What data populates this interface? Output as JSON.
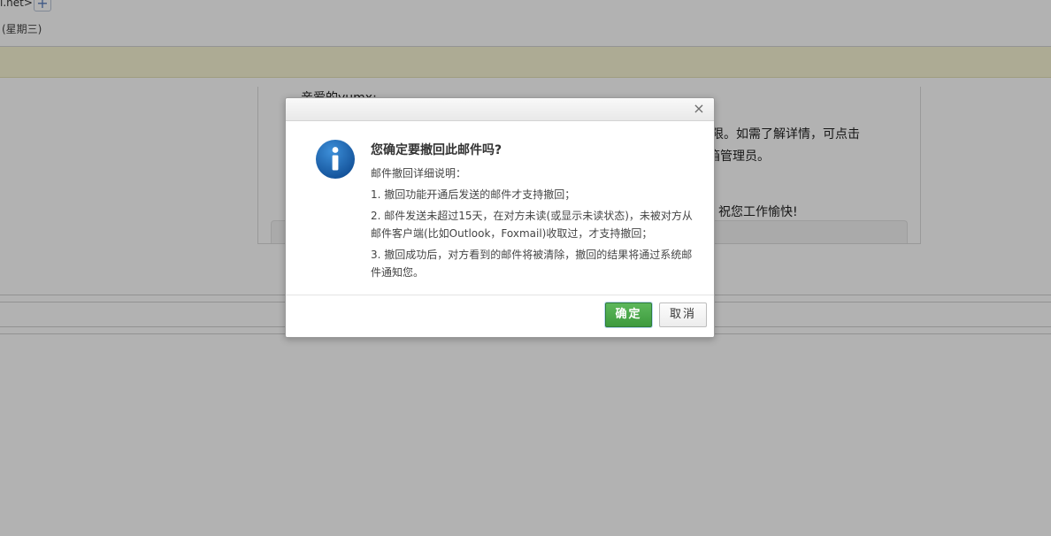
{
  "background": {
    "sender_fragment": "l.net>",
    "add_contact_symbol": "+",
    "date_fragment": "(星期三)",
    "greeting": "亲爱的yumx:",
    "body_line1": "权限。如需了解详情，可点击",
    "body_line2": "箱管理员。",
    "body_line3": "祝您工作愉快!"
  },
  "dialog": {
    "close_symbol": "×",
    "icon": "info-icon",
    "title": "您确定要撤回此邮件吗?",
    "paragraphs": [
      "邮件撤回详细说明：",
      "1. 撤回功能开通后发送的邮件才支持撤回；",
      "2. 邮件发送未超过15天，在对方未读(或显示未读状态)，未被对方从邮件客户端(比如Outlook，Foxmail)收取过，才支持撤回；",
      "3. 撤回成功后，对方看到的邮件将被清除，撤回的结果将通过系统邮件通知您。"
    ],
    "confirm_label": "确定",
    "cancel_label": "取消"
  },
  "colors": {
    "confirm_button": "#4cae4c",
    "info_icon": "#1a6bb8",
    "notice_bar": "#f8f5d5",
    "overlay": "#000000"
  }
}
